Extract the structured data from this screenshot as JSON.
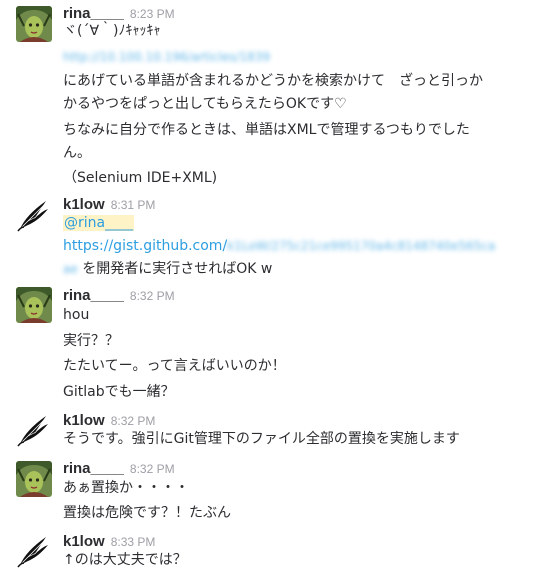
{
  "users": {
    "rina": "rina____",
    "k1low": "k1low"
  },
  "groups": [
    {
      "user": "rina____",
      "time": "8:23 PM",
      "lines": [
        "ヾ(´∀｀)ﾉｷｬｯｷｬ",
        "http://10.100.10.196/articles/1839",
        "にあげている単語が含まれるかどうかを検索かけて　ざっと引っか",
        "かるやつをぱっと出してもらえたらOKです♡",
        "ちなみに自分で作るときは、単語はXMLで管理するつもりでした",
        "ん。",
        "（Selenium IDE+XML)"
      ]
    },
    {
      "user": "k1low",
      "time": "8:31 PM",
      "mention": "@rina____",
      "link_visible": "https://gist.github.com/",
      "link_blurred_1": "k1LoW/275c21ce995170a4c8148740e565ca",
      "link_blurred_2": "ae",
      "link_suffix": " を開発者に実行させればOK w"
    },
    {
      "user": "rina____",
      "time": "8:32 PM",
      "lines": [
        "hou",
        "実行？？",
        "たたいてー。って言えばいいのか！",
        "Gitlabでも一緒？"
      ]
    },
    {
      "user": "k1low",
      "time": "8:32 PM",
      "lines": [
        "そうです。強引にGit管理下のファイル全部の置換を実施します"
      ]
    },
    {
      "user": "rina____",
      "time": "8:32 PM",
      "lines": [
        "あぁ置換か・・・・",
        "置換は危険です？！たぶん"
      ]
    },
    {
      "user": "k1low",
      "time": "8:33 PM",
      "lines": [
        "↑のは大丈夫では？"
      ]
    }
  ]
}
